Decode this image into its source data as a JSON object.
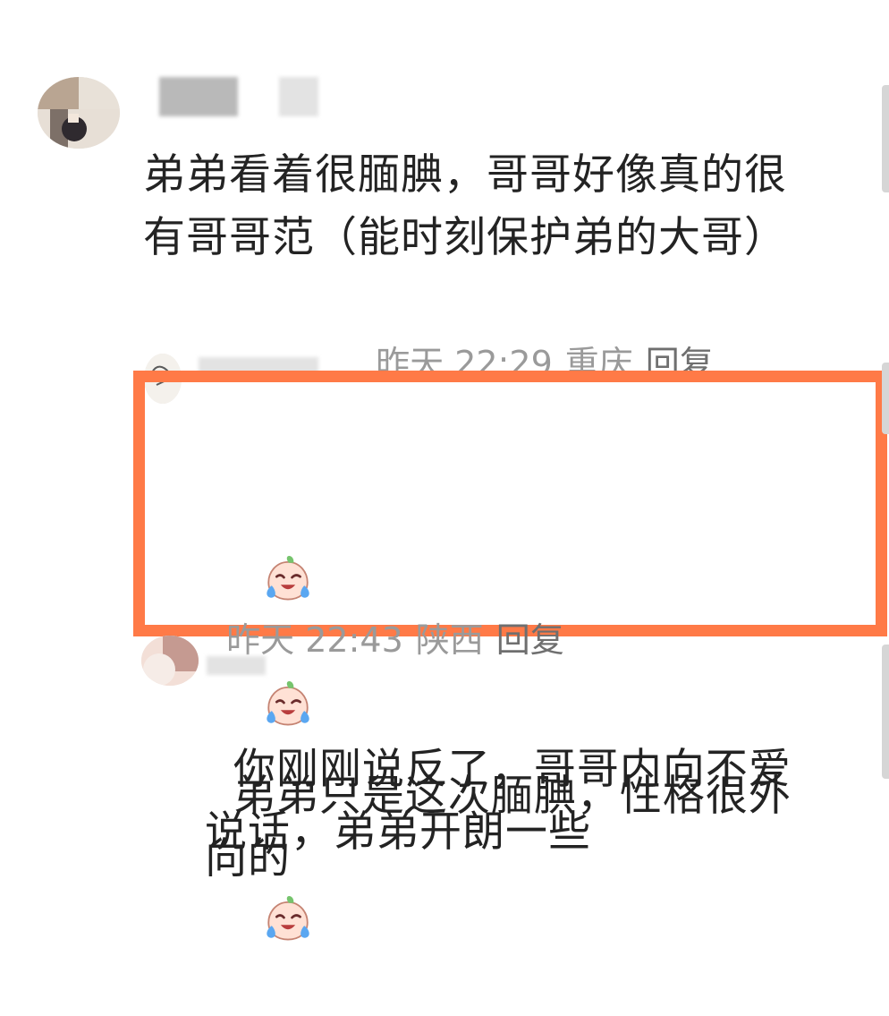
{
  "comments": [
    {
      "text": "弟弟看着很腼腆，哥哥好像真的很有哥哥范（能时刻保护弟的大哥）",
      "time": "昨天 22:29",
      "location": "重庆",
      "reply": "回复"
    },
    {
      "text": "你刚刚说反了，哥哥内向不爱说话，弟弟开朗一些",
      "time": "昨天 22:43",
      "location": "陕西",
      "reply": "回复",
      "emoji_prefix": [
        "crying-laughing-peach-emoji",
        "crying-laughing-peach-emoji"
      ]
    },
    {
      "text": "弟弟只是这次腼腆，性格很外向的",
      "emoji_suffix": [
        "crying-laughing-peach-emoji"
      ]
    }
  ],
  "colors": {
    "highlight_border": "#ff7a47",
    "meta_text": "#9a9a9a"
  }
}
